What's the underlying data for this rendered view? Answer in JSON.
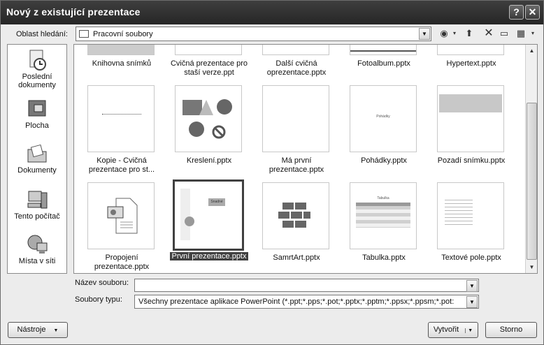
{
  "window": {
    "title": "Nový z existující prezentace"
  },
  "lookin": {
    "label": "Oblast hledání:",
    "value": "Pracovní soubory"
  },
  "places": [
    {
      "label": "Poslední dokumenty"
    },
    {
      "label": "Plocha"
    },
    {
      "label": "Dokumenty"
    },
    {
      "label": "Tento počítač"
    },
    {
      "label": "Místa v síti"
    }
  ],
  "files": [
    {
      "name": "Knihovna snímků"
    },
    {
      "name": "Cvičná prezentace pro staší verze.ppt"
    },
    {
      "name": "Další cvičná oprezentace.pptx"
    },
    {
      "name": "Fotoalbum.pptx"
    },
    {
      "name": "Hypertext.pptx"
    },
    {
      "name": "Kopie - Cvičná prezentace pro st..."
    },
    {
      "name": "Kreslení.pptx"
    },
    {
      "name": "Má první prezentace.pptx"
    },
    {
      "name": "Pohádky.pptx",
      "thumb_text": "Pohádky"
    },
    {
      "name": "Pozadí snímku.pptx"
    },
    {
      "name": "Propojení prezentace.pptx"
    },
    {
      "name": "První prezentace.pptx",
      "thumb_text": "Snadné"
    },
    {
      "name": "SamrtArt.pptx"
    },
    {
      "name": "Tabulka.pptx",
      "thumb_text": "Tabulka"
    },
    {
      "name": "Textové pole.pptx"
    }
  ],
  "filename": {
    "label": "Název souboru:",
    "value": ""
  },
  "filetype": {
    "label": "Soubory typu:",
    "value": "Všechny prezentace aplikace PowerPoint (*.ppt;*.pps;*.pot;*.pptx;*.pptm;*.ppsx;*.ppsm;*.pot:"
  },
  "buttons": {
    "tools": "Nástroje",
    "create": "Vytvořit",
    "cancel": "Storno"
  },
  "selected_file_index": 11
}
